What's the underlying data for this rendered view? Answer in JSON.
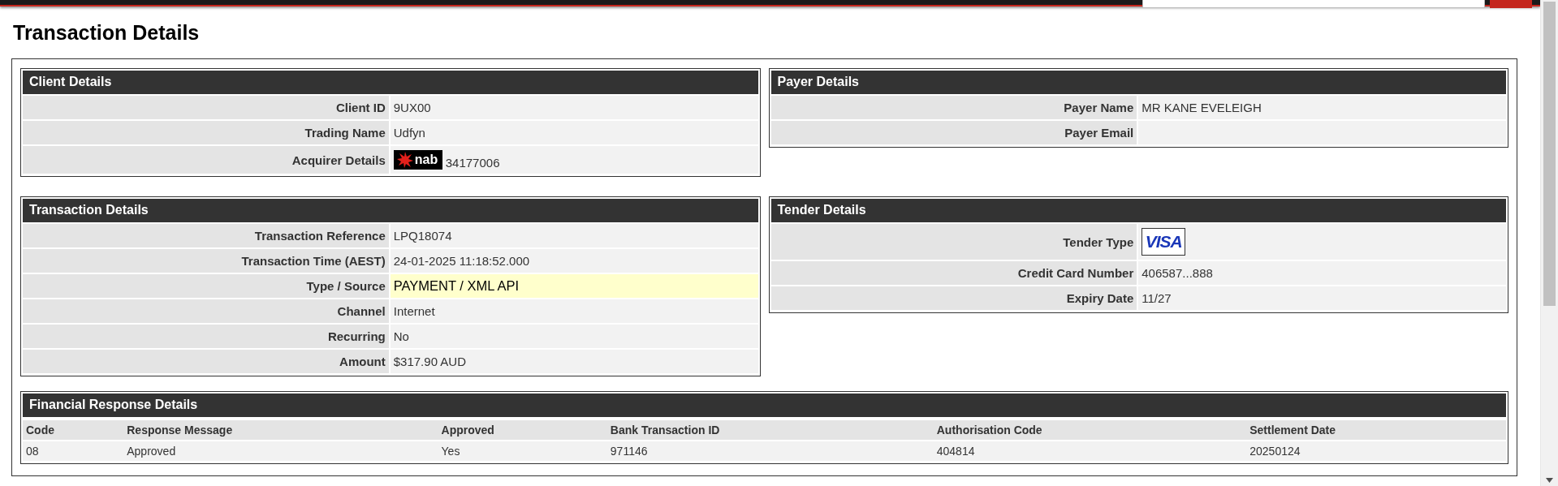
{
  "page_title": "Transaction Details",
  "panels": [
    {
      "title": "Client Details",
      "rows": [
        {
          "kind": "text",
          "label": "Client ID",
          "value": "9UX00",
          "highlighted": false
        },
        {
          "kind": "text",
          "label": "Trading Name",
          "value": "Udfyn",
          "highlighted": false
        },
        {
          "kind": "acquirer",
          "label": "Acquirer Details",
          "logo": "nab",
          "value": "34177006",
          "highlighted": false
        }
      ]
    },
    {
      "title": "Payer Details",
      "rows": [
        {
          "kind": "text",
          "label": "Payer Name",
          "value": "MR KANE EVELEIGH",
          "highlighted": false
        },
        {
          "kind": "text",
          "label": "Payer Email",
          "highlighted": false
        }
      ]
    },
    {
      "title": "Transaction Details",
      "rows": [
        {
          "kind": "text",
          "label": "Transaction Reference",
          "value": "LPQ18074",
          "highlighted": false
        },
        {
          "kind": "text",
          "label": "Transaction Time (AEST)",
          "value": "24-01-2025 11:18:52.000",
          "highlighted": false
        },
        {
          "kind": "text",
          "label": "Type / Source",
          "value": "PAYMENT / XML API",
          "highlighted": true
        },
        {
          "kind": "text",
          "label": "Channel",
          "value": "Internet",
          "highlighted": false
        },
        {
          "kind": "text",
          "label": "Recurring",
          "value": "No",
          "highlighted": false
        },
        {
          "kind": "text",
          "label": "Amount",
          "value": "$317.90 AUD",
          "highlighted": false
        }
      ]
    },
    {
      "title": "Tender Details",
      "rows": [
        {
          "kind": "card",
          "label": "Tender Type",
          "logo": "VISA",
          "highlighted": false
        },
        {
          "kind": "text",
          "label": "Credit Card Number",
          "value": "406587...888",
          "highlighted": false
        },
        {
          "kind": "text",
          "label": "Expiry Date",
          "value": "11/27",
          "highlighted": false
        }
      ]
    }
  ],
  "financial_response": {
    "title": "Financial Response Details",
    "columns": [
      "Code",
      "Response Message",
      "Approved",
      "Bank Transaction ID",
      "Authorisation Code",
      "Settlement Date"
    ],
    "rows": [
      [
        "08",
        "Approved",
        "Yes",
        "971146",
        "404814",
        "20250124"
      ]
    ]
  }
}
